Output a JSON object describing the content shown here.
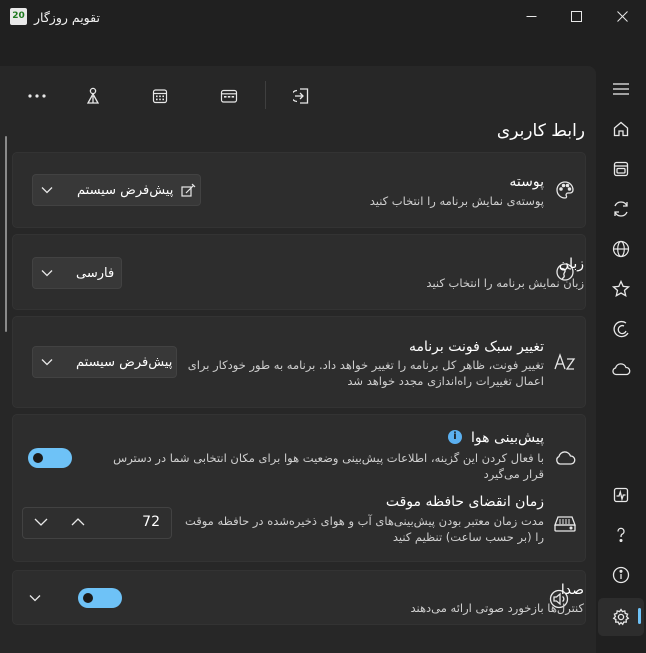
{
  "window": {
    "title": "تقویم روزگار",
    "app_icon_text": "20",
    "minimize_icon": "minimize-icon",
    "maximize_icon": "maximize-icon",
    "close_icon": "close-icon"
  },
  "toolbar": {
    "items": [
      "more-icon",
      "person-pin-icon",
      "calendar-grid-icon",
      "calendar-event-icon",
      "import-icon"
    ]
  },
  "section": {
    "title": "رابط کاربری"
  },
  "cards": {
    "skin": {
      "title": "پوسته",
      "description": "پوسته‌ی نمایش برنامه را انتخاب کنید",
      "value": "پیش‌فرض سیستم",
      "icon": "palette-icon"
    },
    "language": {
      "title": "زبان",
      "description": "زبان نمایش برنامه را انتخاب کنید",
      "value": "فارسی",
      "icon": "globe-language-icon"
    },
    "font": {
      "title": "تغییر سبک فونت برنامه",
      "description_line1": "تغییر فونت، ظاهر کل برنامه را تغییر خواهد داد. برنامه به طور خودکار برای",
      "description_line2": "اعمال تغییرات راه‌اندازی مجدد خواهد شد",
      "value": "پیش‌فرض سیستم",
      "icon": "font-icon"
    },
    "weather": {
      "title": "پیش‌بینی هوا",
      "description": "با فعال کردن این گزینه، اطلاعات پیش‌بینی وضعیت هوا برای مکان انتخابی شما در دسترس قرار می‌گیرد",
      "toggle_on": true,
      "icon": "cloud-icon",
      "info_glyph": "i"
    },
    "cache": {
      "title": "زمان انقضای حافظه موقت",
      "description": "مدت زمان معتبر بودن پیش‌بینی‌های آب و هوای ذخیره‌شده در حافظه موقت را (بر حسب ساعت) تنظیم کنید",
      "value": "72",
      "icon": "storage-icon"
    },
    "sound": {
      "title": "صدا",
      "description": "کنترل‌ها بازخورد صوتی ارائه می‌دهند",
      "toggle_on": true,
      "icon": "speaker-icon"
    }
  },
  "nav": {
    "items": [
      "hamburger-icon",
      "home-icon",
      "calendar-box-icon",
      "sync-icon",
      "globe-icon",
      "star-icon",
      "moon-icon",
      "cloud-icon",
      "activity-icon",
      "help-icon",
      "info-icon",
      "settings-icon"
    ],
    "active": "settings-icon"
  },
  "colors": {
    "accent": "#6ec2f7",
    "background": "#202020",
    "card": "#2d2d2d"
  }
}
